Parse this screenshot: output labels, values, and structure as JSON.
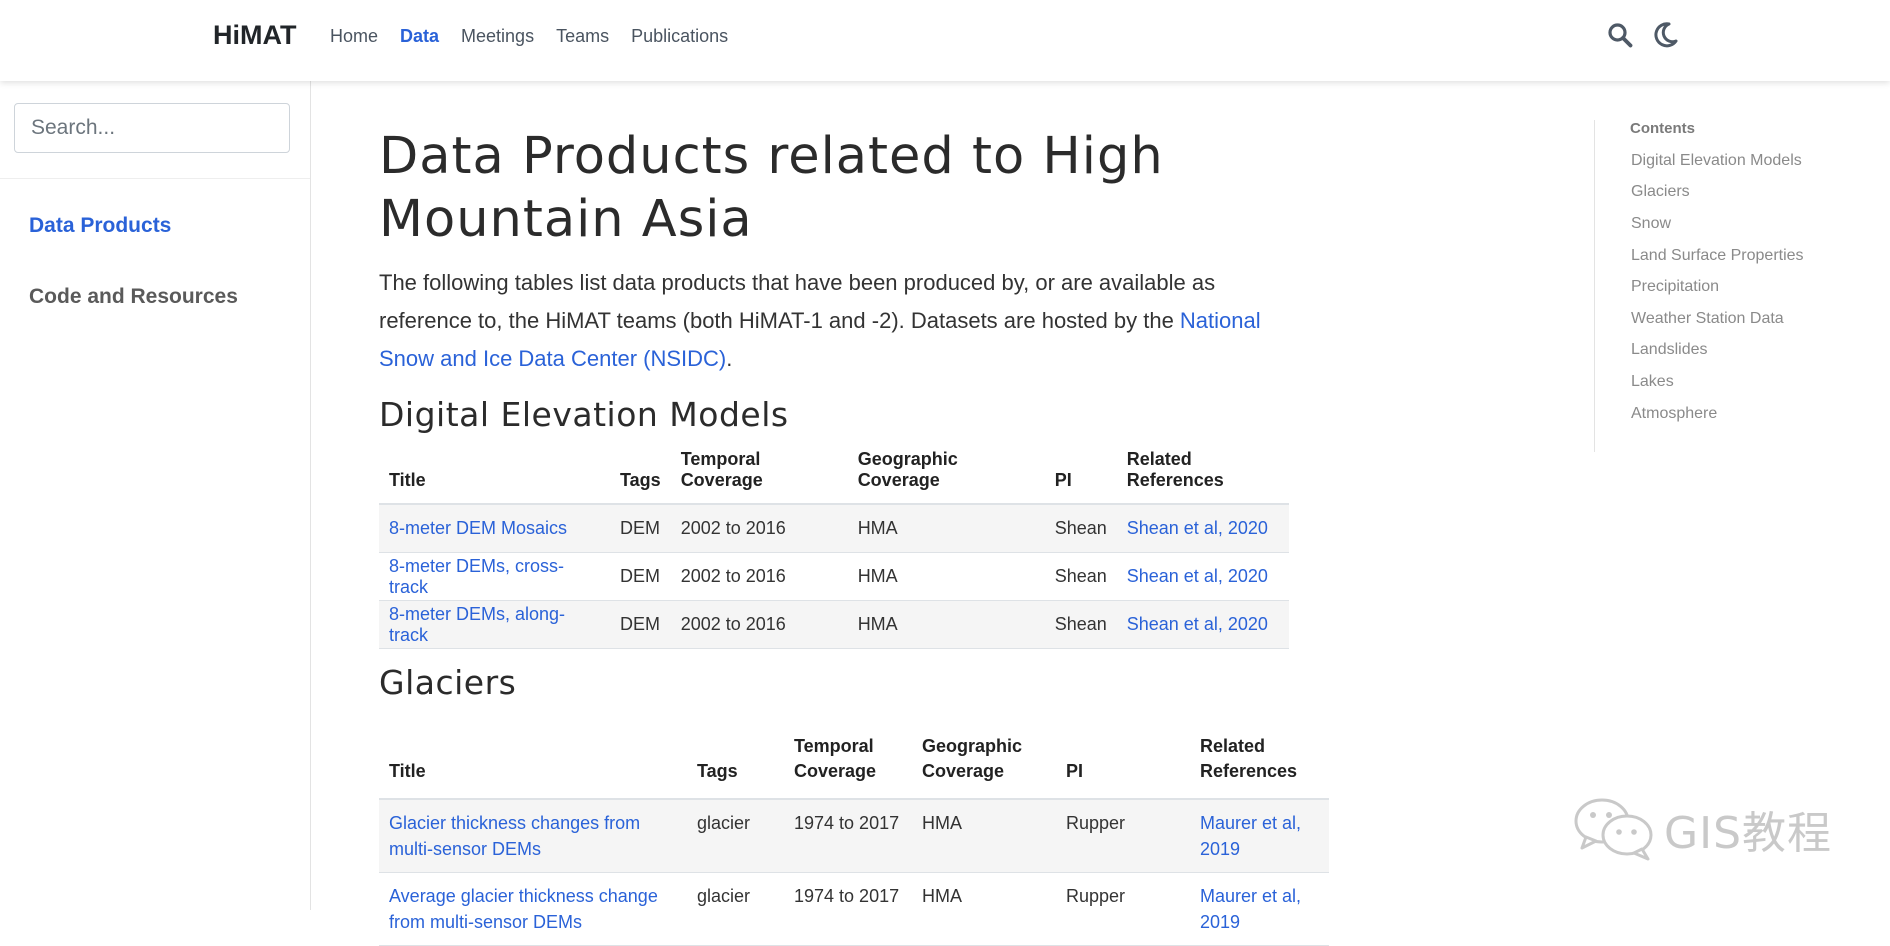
{
  "navbar": {
    "brand": "HiMAT",
    "links": [
      "Home",
      "Data",
      "Meetings",
      "Teams",
      "Publications"
    ],
    "active_link": "Data",
    "search_icon": "search-icon",
    "theme_icon": "moon-icon"
  },
  "sidebar": {
    "search_placeholder": "Search...",
    "items": [
      "Data Products",
      "Code and Resources"
    ],
    "active_item": "Data Products"
  },
  "main": {
    "title": "Data Products related to High Mountain Asia",
    "intro_text": "The following tables list data products that have been produced by, or are available as reference to, the HiMAT teams (both HiMAT-1 and -2). Datasets are hosted by the ",
    "intro_link": "National Snow and Ice Data Center (NSIDC)",
    "intro_end": ".",
    "sections": [
      {
        "title": "Digital Elevation Models",
        "headers": [
          "Title",
          "Tags",
          "Temporal Coverage",
          "Geographic Coverage",
          "PI",
          "Related References"
        ],
        "rows": [
          [
            "8-meter DEM Mosaics",
            "DEM",
            "2002 to 2016",
            "HMA",
            "Shean",
            "Shean et al, 2020"
          ],
          [
            "8-meter DEMs, cross-track",
            "DEM",
            "2002 to 2016",
            "HMA",
            "Shean",
            "Shean et al, 2020"
          ],
          [
            "8-meter DEMs, along-track",
            "DEM",
            "2002 to 2016",
            "HMA",
            "Shean",
            "Shean et al, 2020"
          ]
        ]
      },
      {
        "title": "Glaciers",
        "headers": [
          "Title",
          "Tags",
          "Temporal Coverage",
          "Geographic Coverage",
          "PI",
          "Related References"
        ],
        "rows": [
          [
            "Glacier thickness changes from multi-sensor DEMs",
            "glacier",
            "1974 to 2017",
            "HMA",
            "Rupper",
            "Maurer et al, 2019"
          ],
          [
            "Average glacier thickness change from multi-sensor DEMs",
            "glacier",
            "1974 to 2017",
            "HMA",
            "Rupper",
            "Maurer et al, 2019"
          ]
        ]
      }
    ]
  },
  "toc": {
    "heading": "Contents",
    "items": [
      "Digital Elevation Models",
      "Glaciers",
      "Snow",
      "Land Surface Properties",
      "Precipitation",
      "Weather Station Data",
      "Landslides",
      "Lakes",
      "Atmosphere"
    ]
  },
  "watermark": {
    "text": "GIS教程",
    "icon": "wechat-icon"
  },
  "colors": {
    "accent": "#2a62d8",
    "text": "#333333",
    "muted": "#8a8a8a",
    "stripe": "#f5f5f5"
  }
}
